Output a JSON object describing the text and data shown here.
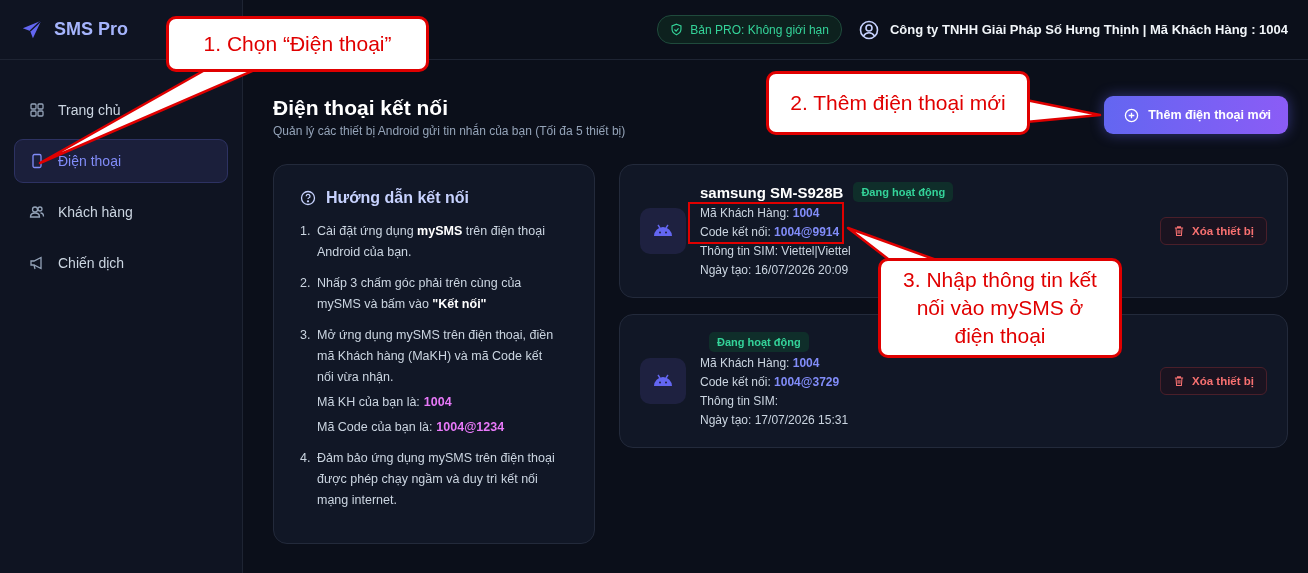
{
  "app": {
    "name": "SMS Pro"
  },
  "sidebar": {
    "items": [
      {
        "label": "Trang chủ",
        "kind": "grid",
        "selected": false
      },
      {
        "label": "Điện thoại",
        "kind": "phone",
        "selected": true
      },
      {
        "label": "Khách hàng",
        "kind": "users",
        "selected": false
      },
      {
        "label": "Chiến dịch",
        "kind": "megaphone",
        "selected": false
      }
    ]
  },
  "header": {
    "plan_badge": "Bản PRO: Không giới hạn",
    "account": "Công ty TNHH Giải Pháp Số Hưng Thịnh | Mã Khách Hàng : 1004"
  },
  "page": {
    "title": "Điện thoại kết nối",
    "subtitle": "Quản lý các thiết bị Android gửi tin nhắn của bạn (Tối đa 5 thiết bị)",
    "add_button": "Thêm điện thoại mới"
  },
  "guide": {
    "title": "Hướng dẫn kết nối",
    "steps": [
      {
        "number": "1.",
        "text": "Cài đặt ứng dụng **mySMS** trên điện thoại Android của bạn."
      },
      {
        "number": "2.",
        "text": "Nhấp 3 chấm góc phải trên cùng của mySMS và bấm vào **\"Kết nối\"**"
      },
      {
        "number": "3.",
        "text": "Mở ứng dụng mySMS trên điện thoại, điền mã Khách hàng (MaKH) và mã Code kết nối vừa nhận.",
        "extras": [
          {
            "label": "Mã KH của bạn là:",
            "value": "1004"
          },
          {
            "label": "Mã Code của bạn là:",
            "value": "1004@1234"
          }
        ]
      },
      {
        "number": "4.",
        "text": "Đảm bảo ứng dụng mySMS trên điện thoại được phép chạy ngầm và duy trì kết nối mạng internet."
      }
    ]
  },
  "devices": [
    {
      "name": "samsung SM-S928B",
      "status": "Đang hoạt động",
      "customer_label": "Mã Khách Hàng:",
      "customer_id": "1004",
      "code_label": "Code kết nối:",
      "code": "1004@9914",
      "sim": "Thông tin SIM: Viettel|Viettel",
      "created": "Ngày tạo: 16/07/2026 20:09",
      "delete_button": "Xóa thiết bị",
      "highlighted": true
    },
    {
      "status": "Đang hoạt động",
      "customer_label": "Mã Khách Hàng:",
      "customer_id": "1004",
      "code_label": "Code kết nối:",
      "code": "1004@3729",
      "sim": "Thông tin SIM:",
      "created": "Ngày tạo: 17/07/2026 15:31",
      "delete_button": "Xóa thiết bị",
      "highlighted": false
    }
  ],
  "annotations": [
    {
      "text": "1. Chọn “Điện thoại”",
      "kind": "sidebar"
    },
    {
      "text": "2. Thêm điện thoại mới",
      "kind": "button"
    },
    {
      "text": "3. Nhập thông tin kết nối vào mySMS ở điện thoại",
      "kind": "device"
    }
  ]
}
